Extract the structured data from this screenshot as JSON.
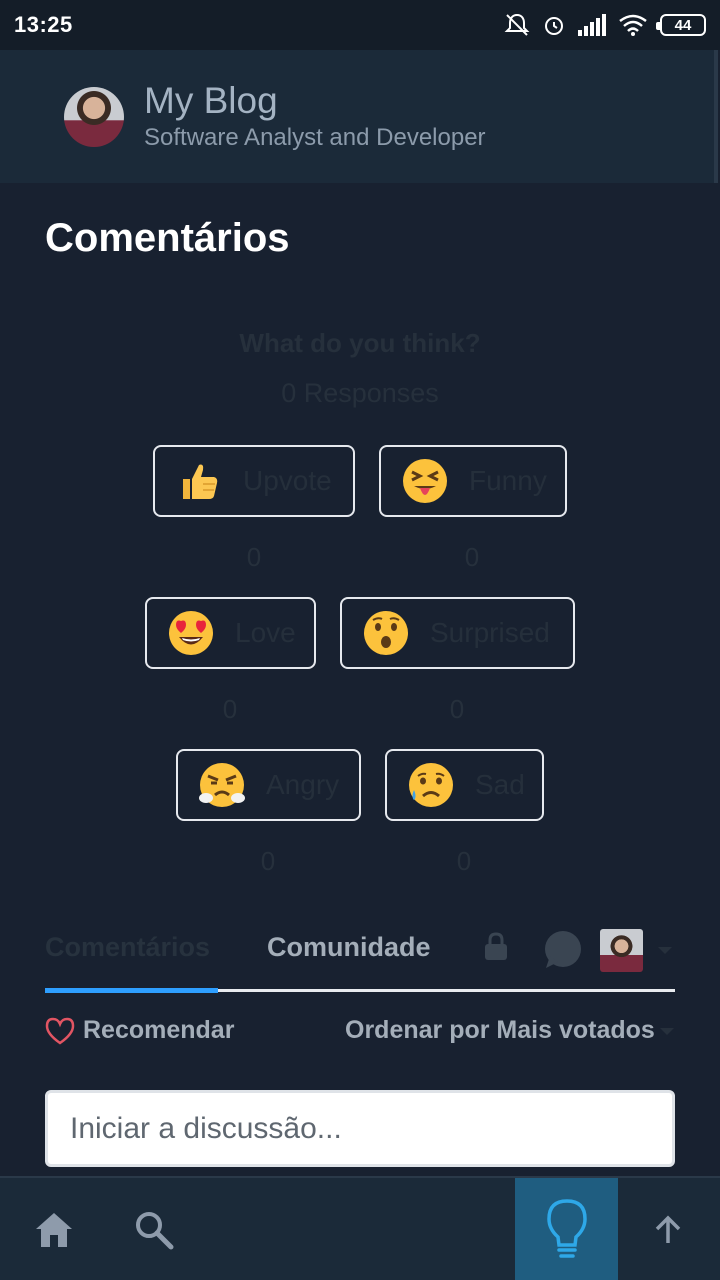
{
  "status_bar": {
    "time": "13:25",
    "battery": "44"
  },
  "header": {
    "title": "My Blog",
    "subtitle": "Software Analyst and Developer"
  },
  "comments_section": {
    "title": "Comentários"
  },
  "reactions": {
    "question": "What do you think?",
    "responses": "0 Responses",
    "items": [
      {
        "label": "Upvote",
        "count": "0",
        "icon": "thumbs-up-icon"
      },
      {
        "label": "Funny",
        "count": "0",
        "icon": "tongue-face-icon"
      },
      {
        "label": "Love",
        "count": "0",
        "icon": "heart-eyes-icon"
      },
      {
        "label": "Surprised",
        "count": "0",
        "icon": "surprised-face-icon"
      },
      {
        "label": "Angry",
        "count": "0",
        "icon": "angry-face-icon"
      },
      {
        "label": "Sad",
        "count": "0",
        "icon": "sad-face-icon"
      }
    ]
  },
  "tabs": {
    "comments": "Comentários",
    "community": "Comunidade"
  },
  "toolbar": {
    "recommend": "Recomendar",
    "sort": "Ordenar por Mais votados"
  },
  "discussion": {
    "placeholder": "Iniciar a discussão..."
  },
  "colors": {
    "background": "#182130",
    "header": "#1b2a39",
    "accent": "#2e9fff",
    "idea_button": "#1f5d80"
  }
}
